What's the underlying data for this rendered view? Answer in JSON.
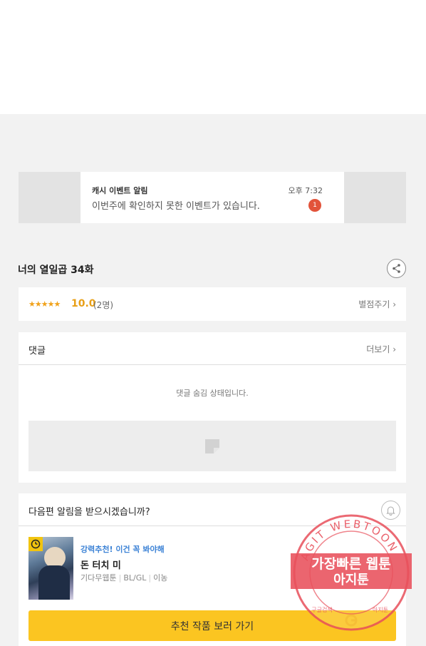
{
  "ad": {
    "title": "캐시 이벤트 알림",
    "message": "이번주에 확인하지 못한 이벤트가 있습니다.",
    "time": "오후 7:32",
    "badge": "1"
  },
  "episode": {
    "title": "너의 열일곱 34화"
  },
  "rating": {
    "stars": "★★★★★",
    "score": "10.0",
    "count": "(2명)",
    "rate_link": "별점주기 ›"
  },
  "comments": {
    "title": "댓글",
    "more_link": "더보기 ›",
    "hidden_message": "댓글 숨김 상태입니다."
  },
  "alarm": {
    "question": "다음편 알림을 받으시겠습니까?"
  },
  "recommendation": {
    "tag": "강력추천! 이건 꼭 봐야해",
    "name": "돈 터치 미",
    "meta": [
      "기다무웹툰",
      "BL/GL",
      "이농"
    ],
    "button_label": "추천 작품 보러 가기"
  },
  "watermark": {
    "ring_text": "AGIT WEBTOON",
    "line1": "가장빠른 웹툰",
    "line2": "아지툰",
    "bottom_left": "구글검색",
    "bottom_right": "아지툰"
  },
  "colors": {
    "accent_yellow": "#fbc521",
    "star_orange": "#f0a21b",
    "tag_blue": "#3d83d6",
    "badge_red": "#e2533a",
    "stamp_red": "#e8505b"
  }
}
